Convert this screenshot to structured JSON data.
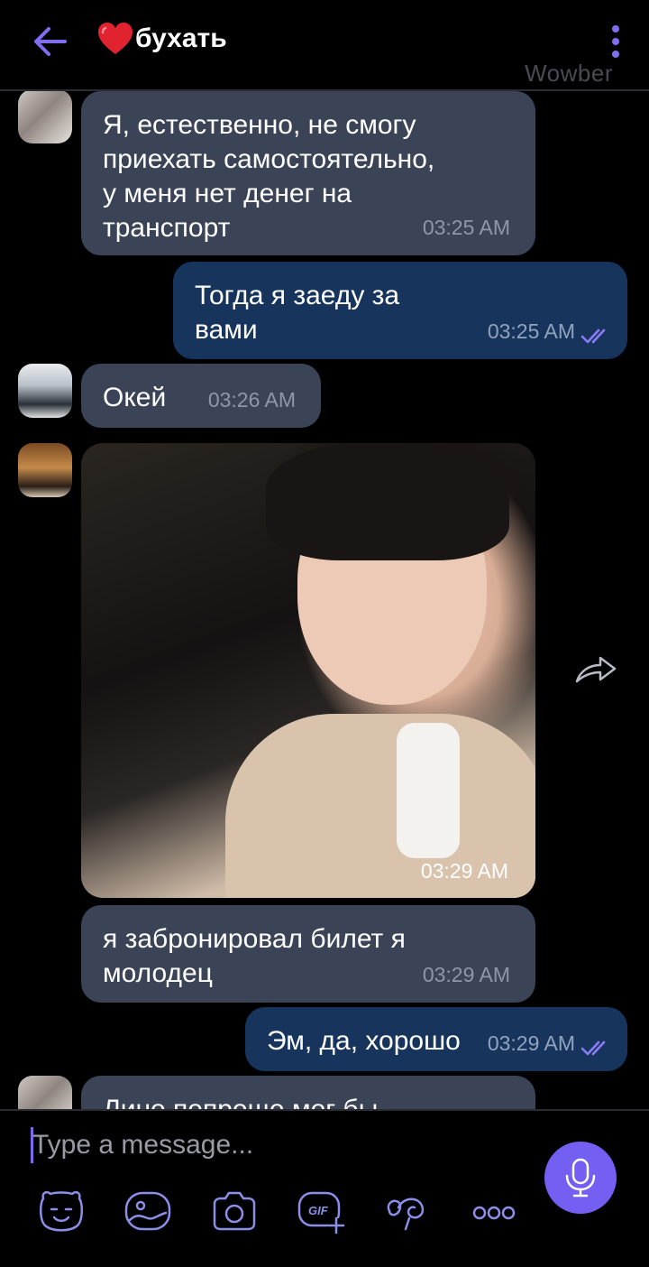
{
  "header": {
    "title": "бухать",
    "watermark": "Wowber",
    "icons": [
      "back-arrow-icon",
      "heart-icon",
      "more-vertical-icon"
    ]
  },
  "messages": [
    {
      "direction": "incoming",
      "text": "Я, естественно, не смогу\nприехать самостоятельно,\nу меня нет денег на\nтранспорт",
      "time": "03:25 AM"
    },
    {
      "direction": "outgoing",
      "text": "Тогда я заеду за\nвами",
      "time": "03:25 AM",
      "status": "read"
    },
    {
      "direction": "incoming",
      "text": "Окей",
      "time": "03:26 AM"
    },
    {
      "direction": "incoming",
      "type": "photo",
      "time": "03:29 AM"
    },
    {
      "direction": "incoming",
      "text": "я забронировал билет я\nмолодец",
      "time": "03:29 AM"
    },
    {
      "direction": "outgoing",
      "text": "Эм, да, хорошо",
      "time": "03:29 AM",
      "status": "read"
    },
    {
      "direction": "incoming",
      "text": "Лино попроще мог бы",
      "time": "",
      "partial": true
    }
  ],
  "composer": {
    "placeholder": "Type a message...",
    "tools": [
      "sticker-icon",
      "gallery-icon",
      "camera-icon",
      "gif-icon",
      "doodle-icon",
      "more-icon"
    ],
    "send_icon": "microphone-icon"
  },
  "colors": {
    "background": "#000000",
    "incoming_bubble": "#3b4457",
    "outgoing_bubble": "#17355c",
    "accent": "#7360f2"
  }
}
